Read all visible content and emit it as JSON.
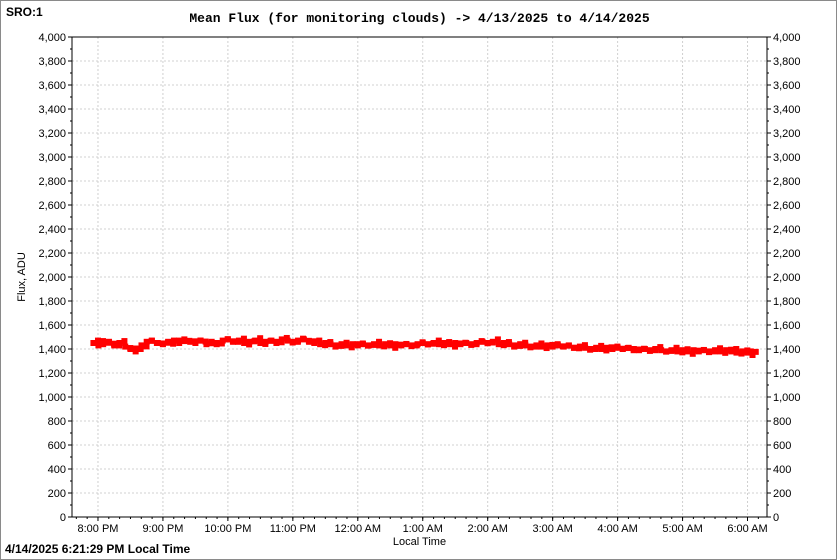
{
  "window": {
    "corner_label": "SRO:1",
    "footer_timestamp": "4/14/2025 6:21:29 PM Local Time"
  },
  "chart_data": {
    "type": "scatter",
    "title": "Mean Flux (for monitoring clouds) -> 4/13/2025 to 4/14/2025",
    "xlabel": "Local Time",
    "ylabel": "Flux, ADU",
    "ylim": [
      0,
      4000
    ],
    "y_ticks": [
      "0",
      "200",
      "400",
      "600",
      "800",
      "1,000",
      "1,200",
      "1,400",
      "1,600",
      "1,800",
      "2,000",
      "2,200",
      "2,400",
      "2,600",
      "2,800",
      "3,000",
      "3,200",
      "3,400",
      "3,600",
      "3,800",
      "4,000"
    ],
    "x_ticks": [
      "8:00 PM",
      "9:00 PM",
      "10:00 PM",
      "11:00 PM",
      "12:00 AM",
      "1:00 AM",
      "2:00 AM",
      "3:00 AM",
      "4:00 AM",
      "5:00 AM",
      "6:00 AM"
    ],
    "x_range_hours": [
      19.6,
      30.3
    ],
    "grid": true,
    "marker_color": "#ff0000",
    "series": [
      {
        "points": [
          [
            19.93,
            1450
          ],
          [
            20.0,
            1470
          ],
          [
            20.08,
            1440
          ],
          [
            20.17,
            1460
          ],
          [
            20.25,
            1430
          ],
          [
            20.33,
            1450
          ],
          [
            20.42,
            1420
          ],
          [
            20.5,
            1400
          ],
          [
            20.58,
            1380
          ],
          [
            20.67,
            1430
          ],
          [
            20.75,
            1460
          ],
          [
            20.83,
            1470
          ],
          [
            20.92,
            1450
          ],
          [
            21.0,
            1440
          ],
          [
            21.08,
            1460
          ],
          [
            21.17,
            1470
          ],
          [
            21.25,
            1450
          ],
          [
            21.33,
            1480
          ],
          [
            21.42,
            1460
          ],
          [
            21.5,
            1450
          ],
          [
            21.58,
            1470
          ],
          [
            21.67,
            1440
          ],
          [
            21.75,
            1460
          ],
          [
            21.83,
            1450
          ],
          [
            21.92,
            1470
          ],
          [
            22.0,
            1480
          ],
          [
            22.08,
            1460
          ],
          [
            22.17,
            1470
          ],
          [
            22.25,
            1450
          ],
          [
            22.33,
            1460
          ],
          [
            22.42,
            1470
          ],
          [
            22.5,
            1450
          ],
          [
            22.58,
            1460
          ],
          [
            22.67,
            1470
          ],
          [
            22.75,
            1460
          ],
          [
            22.83,
            1480
          ],
          [
            22.92,
            1470
          ],
          [
            23.0,
            1460
          ],
          [
            23.08,
            1470
          ],
          [
            23.17,
            1480
          ],
          [
            23.25,
            1460
          ],
          [
            23.33,
            1450
          ],
          [
            23.42,
            1440
          ],
          [
            23.5,
            1450
          ],
          [
            23.58,
            1440
          ],
          [
            23.67,
            1430
          ],
          [
            23.75,
            1440
          ],
          [
            23.83,
            1430
          ],
          [
            23.92,
            1440
          ],
          [
            24.0,
            1430
          ],
          [
            24.08,
            1440
          ],
          [
            24.17,
            1430
          ],
          [
            24.25,
            1440
          ],
          [
            24.33,
            1430
          ],
          [
            24.42,
            1440
          ],
          [
            24.5,
            1430
          ],
          [
            24.58,
            1440
          ],
          [
            24.67,
            1430
          ],
          [
            24.75,
            1440
          ],
          [
            24.83,
            1430
          ],
          [
            24.92,
            1440
          ],
          [
            25.0,
            1450
          ],
          [
            25.08,
            1440
          ],
          [
            25.17,
            1450
          ],
          [
            25.25,
            1440
          ],
          [
            25.33,
            1450
          ],
          [
            25.42,
            1440
          ],
          [
            25.5,
            1450
          ],
          [
            25.58,
            1440
          ],
          [
            25.67,
            1450
          ],
          [
            25.75,
            1440
          ],
          [
            25.83,
            1450
          ],
          [
            25.92,
            1460
          ],
          [
            26.0,
            1450
          ],
          [
            26.08,
            1460
          ],
          [
            26.17,
            1440
          ],
          [
            26.25,
            1450
          ],
          [
            26.33,
            1440
          ],
          [
            26.42,
            1430
          ],
          [
            26.5,
            1440
          ],
          [
            26.58,
            1430
          ],
          [
            26.67,
            1420
          ],
          [
            26.75,
            1430
          ],
          [
            26.83,
            1420
          ],
          [
            26.92,
            1430
          ],
          [
            27.0,
            1420
          ],
          [
            27.08,
            1430
          ],
          [
            27.17,
            1420
          ],
          [
            27.25,
            1430
          ],
          [
            27.33,
            1410
          ],
          [
            27.42,
            1420
          ],
          [
            27.5,
            1410
          ],
          [
            27.58,
            1400
          ],
          [
            27.67,
            1410
          ],
          [
            27.75,
            1400
          ],
          [
            27.83,
            1410
          ],
          [
            27.92,
            1400
          ],
          [
            28.0,
            1410
          ],
          [
            28.08,
            1400
          ],
          [
            28.17,
            1410
          ],
          [
            28.25,
            1400
          ],
          [
            28.33,
            1390
          ],
          [
            28.42,
            1400
          ],
          [
            28.5,
            1390
          ],
          [
            28.58,
            1400
          ],
          [
            28.67,
            1390
          ],
          [
            28.75,
            1380
          ],
          [
            28.83,
            1390
          ],
          [
            28.92,
            1380
          ],
          [
            29.0,
            1390
          ],
          [
            29.08,
            1380
          ],
          [
            29.17,
            1390
          ],
          [
            29.25,
            1380
          ],
          [
            29.33,
            1390
          ],
          [
            29.42,
            1380
          ],
          [
            29.5,
            1390
          ],
          [
            29.58,
            1380
          ],
          [
            29.67,
            1390
          ],
          [
            29.75,
            1380
          ],
          [
            29.83,
            1370
          ],
          [
            29.92,
            1380
          ],
          [
            30.0,
            1370
          ],
          [
            30.05,
            1380
          ]
        ]
      }
    ]
  }
}
